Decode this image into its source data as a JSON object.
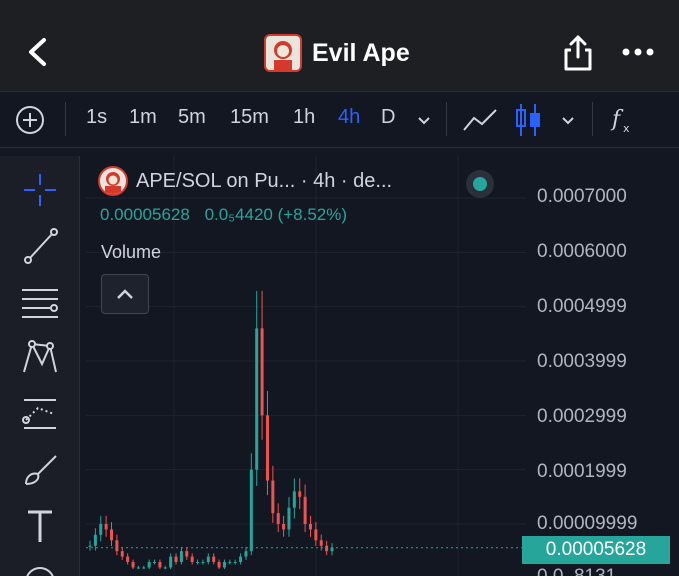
{
  "header": {
    "title": "Evil Ape",
    "back_icon": "chevron-left-icon",
    "share_icon": "share-icon",
    "more_icon": "more-horizontal-icon"
  },
  "toolbar": {
    "intervals": [
      "1s",
      "1m",
      "5m",
      "15m",
      "1h",
      "4h",
      "D"
    ],
    "active_interval": "4h",
    "add_icon": "plus-circle-icon",
    "chart_types": [
      "line-chart-icon",
      "candlestick-icon"
    ],
    "indicators_icon": "fx-icon"
  },
  "left_tools": [
    "crosshair-icon",
    "trend-line-icon",
    "fib-icon",
    "pattern-icon",
    "prediction-icon",
    "brush-icon",
    "text-icon",
    "circle-icon"
  ],
  "chart": {
    "symbol_title": "APE/SOL on Pu... · 4h · de...",
    "price_value": "0.00005628",
    "price_change": "0.0₅4420 (+8.52%)",
    "volume_label": "Volume",
    "current_price_tag": "0.00005628",
    "y_axis_labels": [
      "0.0007000",
      "0.0006000",
      "0.0004999",
      "0.0003999",
      "0.0002999",
      "0.0001999",
      "0.00009999",
      "0.0..8131"
    ],
    "colors": {
      "up": "#26a69a",
      "down": "#ef5350",
      "accent": "#2962ff"
    }
  },
  "chart_data": {
    "type": "candlestick",
    "ylim": [
      0,
      0.0007
    ],
    "y_ticks": [
      9.999e-05,
      0.0001999,
      0.0002999,
      0.0003999,
      0.0004999,
      0.0006,
      0.0007
    ],
    "series": [
      {
        "values": [
          6e-05,
          8e-05,
          0.0001,
          9e-05,
          7e-05,
          5e-05,
          4e-05,
          3e-05,
          2e-05,
          2e-05,
          2e-05,
          3e-05,
          3e-05,
          2e-05,
          2e-05,
          4e-05,
          3e-05,
          5e-05,
          4e-05,
          3e-05,
          3e-05,
          3e-05,
          4e-05,
          3e-05,
          2e-05,
          3e-05,
          3e-05,
          3e-05,
          4e-05,
          5e-05,
          0.0002,
          0.00046,
          0.0003,
          0.00018,
          0.00012,
          0.0001,
          9e-05,
          0.00013,
          0.00016,
          0.00015,
          0.0001,
          9e-05,
          7e-05,
          6e-05,
          5e-05,
          5.628e-05
        ]
      }
    ]
  }
}
